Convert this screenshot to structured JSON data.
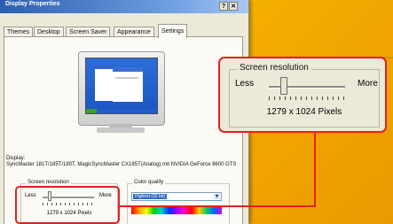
{
  "window": {
    "title": "Display Properties",
    "help_label": "?",
    "close_label": "✕"
  },
  "tabs": [
    {
      "label": "Themes"
    },
    {
      "label": "Desktop"
    },
    {
      "label": "Screen Saver"
    },
    {
      "label": "Appearance"
    },
    {
      "label": "Settings",
      "active": true
    }
  ],
  "display": {
    "label": "Display:",
    "info": "SyncMaster 181T/185T/180T, MagicSyncMaster CX185T(Analog) mit NVIDIA GeForce 8600 GTS"
  },
  "screen_resolution": {
    "title": "Screen resolution",
    "less_label": "Less",
    "more_label": "More",
    "value": "1279 x 1024 Pixels",
    "slider_position": 0.17
  },
  "color_quality": {
    "title": "Color quality",
    "selected": "Highest (32 bit)",
    "arrow": "▼"
  },
  "callout": {
    "title": "Screen resolution",
    "less_label": "Less",
    "more_label": "More",
    "value": "1279 x 1024 Pixels"
  },
  "colors": {
    "highlight": "#e42020",
    "background": "#f2a900",
    "titlebar": "#2b5fb0"
  }
}
